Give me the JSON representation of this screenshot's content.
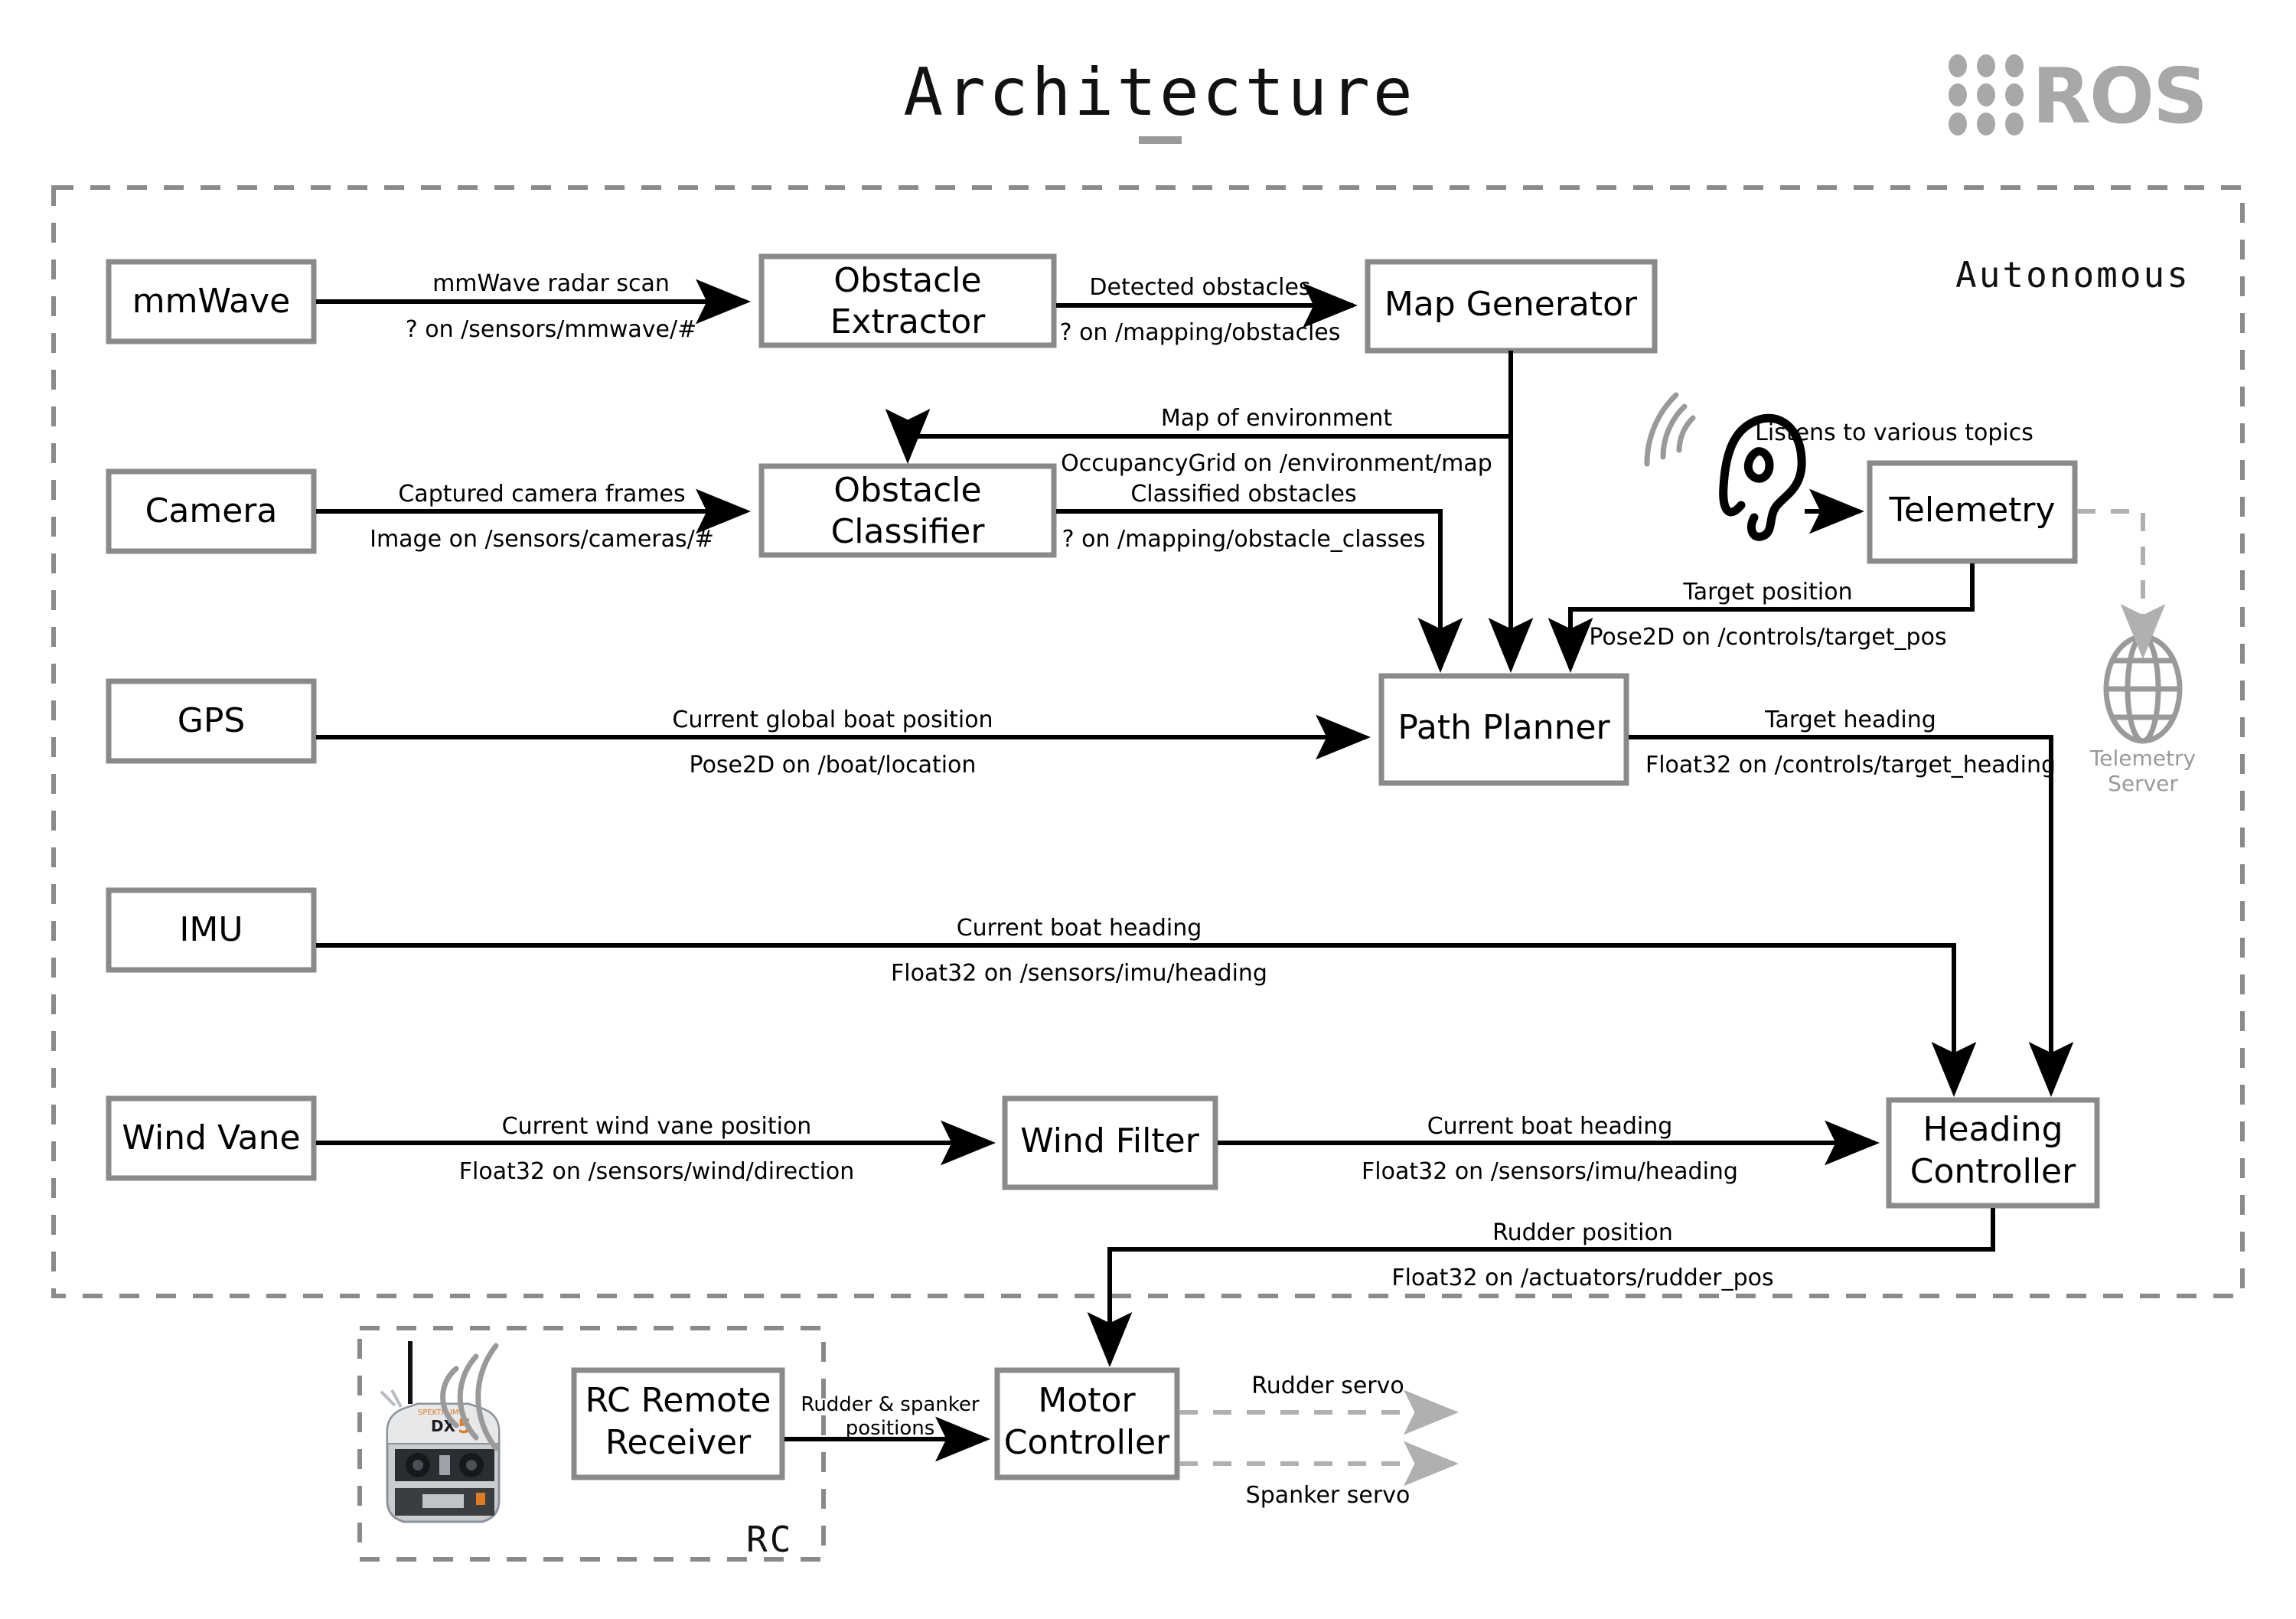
{
  "header": {
    "title": "Architecture",
    "logo_text": "ROS",
    "logo_icon": "ros-dot-grid-icon"
  },
  "zones": [
    {
      "id": "autonomous",
      "label": "Autonomous"
    },
    {
      "id": "rc",
      "label": "RC"
    }
  ],
  "nodes": {
    "mmwave": "mmWave",
    "camera": "Camera",
    "gps": "GPS",
    "imu": "IMU",
    "wind_vane": "Wind Vane",
    "obstacle_extractor_l1": "Obstacle",
    "obstacle_extractor_l2": "Extractor",
    "obstacle_classifier_l1": "Obstacle",
    "obstacle_classifier_l2": "Classifier",
    "map_generator": "Map Generator",
    "telemetry": "Telemetry",
    "path_planner": "Path Planner",
    "wind_filter": "Wind Filter",
    "heading_controller_l1": "Heading",
    "heading_controller_l2": "Controller",
    "rc_remote_receiver_l1": "RC Remote",
    "rc_remote_receiver_l2": "Receiver",
    "motor_controller_l1": "Motor",
    "motor_controller_l2": "Controller",
    "telemetry_server_l1": "Telemetry",
    "telemetry_server_l2": "Server"
  },
  "edges": {
    "mmwave_to_extractor": {
      "top": "mmWave radar scan",
      "bottom": "? on /sensors/mmwave/#"
    },
    "extractor_to_map": {
      "top": "Detected obstacles",
      "bottom": "? on /mapping/obstacles"
    },
    "camera_to_classifier": {
      "top": "Captured camera frames",
      "bottom": "Image on /sensors/cameras/#"
    },
    "map_to_classifier": {
      "top": "Map of environment",
      "bottom": "OccupancyGrid on /environment/map"
    },
    "classifier_to_planner": {
      "top": "Classified obstacles",
      "bottom": "? on /mapping/obstacle_classes"
    },
    "telemetry_listen": {
      "top": "Listens to various topics"
    },
    "telemetry_to_planner": {
      "top": "Target position",
      "bottom": "Pose2D on /controls/target_pos"
    },
    "gps_to_planner": {
      "top": "Current global boat position",
      "bottom": "Pose2D on /boat/location"
    },
    "planner_to_heading": {
      "top": "Target heading",
      "bottom": "Float32 on /controls/target_heading"
    },
    "imu_to_heading": {
      "top": "Current boat heading",
      "bottom": "Float32 on /sensors/imu/heading"
    },
    "windvane_to_filter": {
      "top": "Current wind vane position",
      "bottom": "Float32 on /sensors/wind/direction"
    },
    "filter_to_heading": {
      "top": "Current boat heading",
      "bottom": "Float32 on /sensors/imu/heading"
    },
    "heading_to_motor": {
      "top": "Rudder position",
      "bottom": "Float32 on /actuators/rudder_pos"
    },
    "rcrx_to_motor": {
      "top": "Rudder & spanker",
      "bottom": "positions"
    },
    "motor_rudder_servo": {
      "top": "Rudder servo"
    },
    "motor_spanker_servo": {
      "top": "Spanker servo"
    }
  },
  "icons": {
    "ear": "ear-listening-icon",
    "globe": "globe-server-icon",
    "rc_transmitter": "rc-transmitter-icon",
    "radio_waves": "radio-waves-icon"
  },
  "colors": {
    "box_border": "#8a8a8a",
    "zone_border": "#8a8a8a",
    "line": "#000000",
    "muted": "#9a9a9a",
    "logo": "#a8a8a8"
  }
}
